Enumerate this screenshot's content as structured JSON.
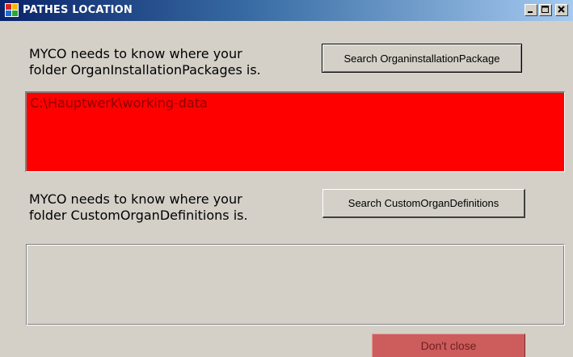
{
  "window": {
    "title": "PATHES LOCATION",
    "controls": {
      "minimize": "minimize",
      "maximize": "maximize",
      "close": "close"
    }
  },
  "section1": {
    "description_line1": "MYCO needs to know where your",
    "description_line2": "folder OrganInstallationPackages is.",
    "button_label": "Search OrganinstallationPackage",
    "path_value": "C:\\Hauptwerk\\working-data"
  },
  "section2": {
    "description_line1": "MYCO needs to know where your",
    "description_line2": "folder CustomOrganDefinitions is.",
    "button_label": "Search CustomOrganDefinitions",
    "path_value": ""
  },
  "footer": {
    "close_button_label": "Don't close"
  },
  "colors": {
    "title_gradient_start": "#0a246a",
    "title_gradient_end": "#a6caf0",
    "window_bg": "#d4d0c8",
    "path1_bg": "#ff0000",
    "close_button_bg": "#cd5c5c"
  }
}
